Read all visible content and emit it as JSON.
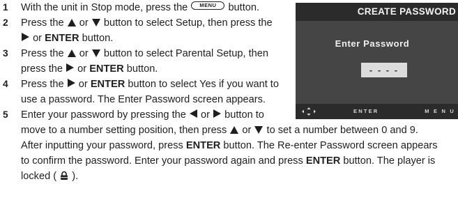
{
  "steps": [
    {
      "number": "1",
      "text_before": "With the unit in Stop mode, press the",
      "button_label": "MENU",
      "text_after": "button."
    },
    {
      "number": "2",
      "line1": "Press the",
      "line1_or": "or",
      "line1_rest": "button to select Setup, then press the",
      "line2_or": "or",
      "line2_bold": "ENTER",
      "line2_rest": "button."
    },
    {
      "number": "3",
      "line1": "Press the",
      "line1_or": "or",
      "line1_rest": "button to select Parental Setup, then",
      "line2_pre": "press the",
      "line2_or": "or",
      "line2_bold": "ENTER",
      "line2_rest": "button."
    },
    {
      "number": "4",
      "line1_pre": "Press the",
      "line1_or": "or",
      "line1_bold": "ENTER",
      "line1_rest": "button to select Yes if you want to",
      "line2": "use a password. The Enter Password screen appears."
    },
    {
      "number": "5",
      "line1_pre": "Enter your password by pressing the",
      "line1_or": "or",
      "line1_rest": "button to",
      "line2_pre": "move to a number setting position, then press",
      "line2_or": "or",
      "line2_rest": "to set a number between 0 and 9.",
      "line3_pre": "After inputting your password, press",
      "line3_bold": "ENTER",
      "line3_rest": "button. The Re-enter Password screen appears",
      "line4_pre": "to confirm the password. Enter your password again and press",
      "line4_bold": "ENTER",
      "line4_rest": "button. The player is",
      "line5_pre": "locked (",
      "line5_post": ")."
    }
  ],
  "screen": {
    "title": "CREATE PASSWORD",
    "prompt": "Enter Password",
    "password_value": "- - - -",
    "footer_enter": "ENTER",
    "footer_menu": "M E N U"
  },
  "icons": {
    "up": "up-triangle-icon",
    "down": "down-triangle-icon",
    "left": "left-triangle-icon",
    "right": "right-triangle-icon",
    "lock": "lock-icon",
    "nav": "arrow-pad-icon"
  },
  "colors": {
    "text": "#1f1f1f",
    "screen_bg": "#454545",
    "screen_bar": "#2b2b2b",
    "pw_box": "#dcdcdc"
  }
}
